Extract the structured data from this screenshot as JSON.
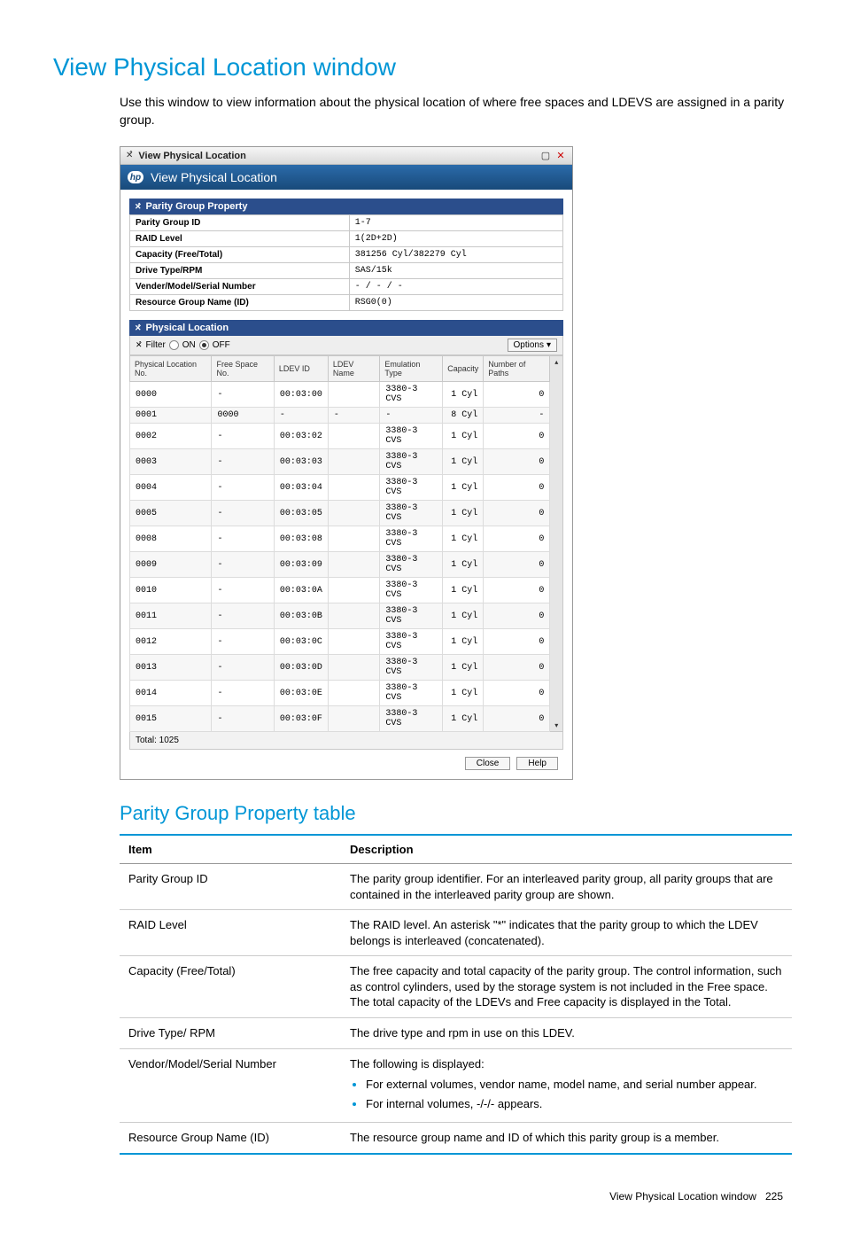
{
  "page": {
    "title": "View Physical Location window",
    "intro": "Use this window to view information about the physical location of where free spaces and LDEVS are assigned in a parity group.",
    "subhead": "Parity Group Property table",
    "footer_text": "View Physical Location window",
    "footer_page": "225"
  },
  "window": {
    "titlebar_text": "View Physical Location",
    "banner_text": "View Physical Location",
    "hp_logo": "hp",
    "max_icon": "▢",
    "close_icon": "✕",
    "parity_group_head": "Parity Group Property",
    "physical_location_head": "Physical Location",
    "filter_label": "Filter",
    "on_label": "ON",
    "off_label": "OFF",
    "options_label": "Options",
    "total_label": "Total: 1025",
    "close_btn": "Close",
    "help_btn": "Help"
  },
  "kv": [
    {
      "k": "Parity Group ID",
      "v": "1-7"
    },
    {
      "k": "RAID Level",
      "v": "1(2D+2D)"
    },
    {
      "k": "Capacity (Free/Total)",
      "v": "381256 Cyl/382279 Cyl"
    },
    {
      "k": "Drive Type/RPM",
      "v": "SAS/15k"
    },
    {
      "k": "Vender/Model/Serial Number",
      "v": "- / - / -"
    },
    {
      "k": "Resource Group Name (ID)",
      "v": "RSG0(0)"
    }
  ],
  "grid_headers": {
    "phys": "Physical Location No.",
    "free": "Free Space No.",
    "ldev": "LDEV ID",
    "lname": "LDEV Name",
    "emul": "Emulation Type",
    "cap": "Capacity",
    "paths": "Number of Paths"
  },
  "grid_rows": [
    {
      "phys": "0000",
      "free": "-",
      "ldev": "00:03:00",
      "lname": "",
      "emul": "3380-3 CVS",
      "cap": "1 Cyl",
      "paths": "0"
    },
    {
      "phys": "0001",
      "free": "0000",
      "ldev": "-",
      "lname": "-",
      "emul": "-",
      "cap": "8 Cyl",
      "paths": "-"
    },
    {
      "phys": "0002",
      "free": "-",
      "ldev": "00:03:02",
      "lname": "",
      "emul": "3380-3 CVS",
      "cap": "1 Cyl",
      "paths": "0"
    },
    {
      "phys": "0003",
      "free": "-",
      "ldev": "00:03:03",
      "lname": "",
      "emul": "3380-3 CVS",
      "cap": "1 Cyl",
      "paths": "0"
    },
    {
      "phys": "0004",
      "free": "-",
      "ldev": "00:03:04",
      "lname": "",
      "emul": "3380-3 CVS",
      "cap": "1 Cyl",
      "paths": "0"
    },
    {
      "phys": "0005",
      "free": "-",
      "ldev": "00:03:05",
      "lname": "",
      "emul": "3380-3 CVS",
      "cap": "1 Cyl",
      "paths": "0"
    },
    {
      "phys": "0008",
      "free": "-",
      "ldev": "00:03:08",
      "lname": "",
      "emul": "3380-3 CVS",
      "cap": "1 Cyl",
      "paths": "0"
    },
    {
      "phys": "0009",
      "free": "-",
      "ldev": "00:03:09",
      "lname": "",
      "emul": "3380-3 CVS",
      "cap": "1 Cyl",
      "paths": "0"
    },
    {
      "phys": "0010",
      "free": "-",
      "ldev": "00:03:0A",
      "lname": "",
      "emul": "3380-3 CVS",
      "cap": "1 Cyl",
      "paths": "0"
    },
    {
      "phys": "0011",
      "free": "-",
      "ldev": "00:03:0B",
      "lname": "",
      "emul": "3380-3 CVS",
      "cap": "1 Cyl",
      "paths": "0"
    },
    {
      "phys": "0012",
      "free": "-",
      "ldev": "00:03:0C",
      "lname": "",
      "emul": "3380-3 CVS",
      "cap": "1 Cyl",
      "paths": "0"
    },
    {
      "phys": "0013",
      "free": "-",
      "ldev": "00:03:0D",
      "lname": "",
      "emul": "3380-3 CVS",
      "cap": "1 Cyl",
      "paths": "0"
    },
    {
      "phys": "0014",
      "free": "-",
      "ldev": "00:03:0E",
      "lname": "",
      "emul": "3380-3 CVS",
      "cap": "1 Cyl",
      "paths": "0"
    },
    {
      "phys": "0015",
      "free": "-",
      "ldev": "00:03:0F",
      "lname": "",
      "emul": "3380-3 CVS",
      "cap": "1 Cyl",
      "paths": "0"
    }
  ],
  "desc_headers": {
    "item": "Item",
    "desc": "Description"
  },
  "desc_rows": [
    {
      "item": "Parity Group ID",
      "desc": "The parity group identifier. For an interleaved parity group, all parity groups that are contained in the interleaved parity group are shown."
    },
    {
      "item": "RAID Level",
      "desc": "The RAID level. An asterisk \"*\" indicates that the parity group to which the LDEV belongs is interleaved (concatenated)."
    },
    {
      "item": "Capacity (Free/Total)",
      "desc": "The free capacity and total capacity of the parity group. The control information, such as control cylinders, used by the storage system is not included in the Free space. The total capacity of the LDEVs and Free capacity is displayed in the Total."
    },
    {
      "item": "Drive Type/ RPM",
      "desc": "The drive type and rpm in use on this LDEV."
    },
    {
      "item": "Vendor/Model/Serial Number",
      "desc": "The following is displayed:",
      "bullets": [
        "For external volumes, vendor name, model name, and serial number appear.",
        "For internal volumes, -/-/- appears."
      ]
    },
    {
      "item": "Resource Group Name (ID)",
      "desc": "The resource group name and ID of which this parity group is a member."
    }
  ]
}
